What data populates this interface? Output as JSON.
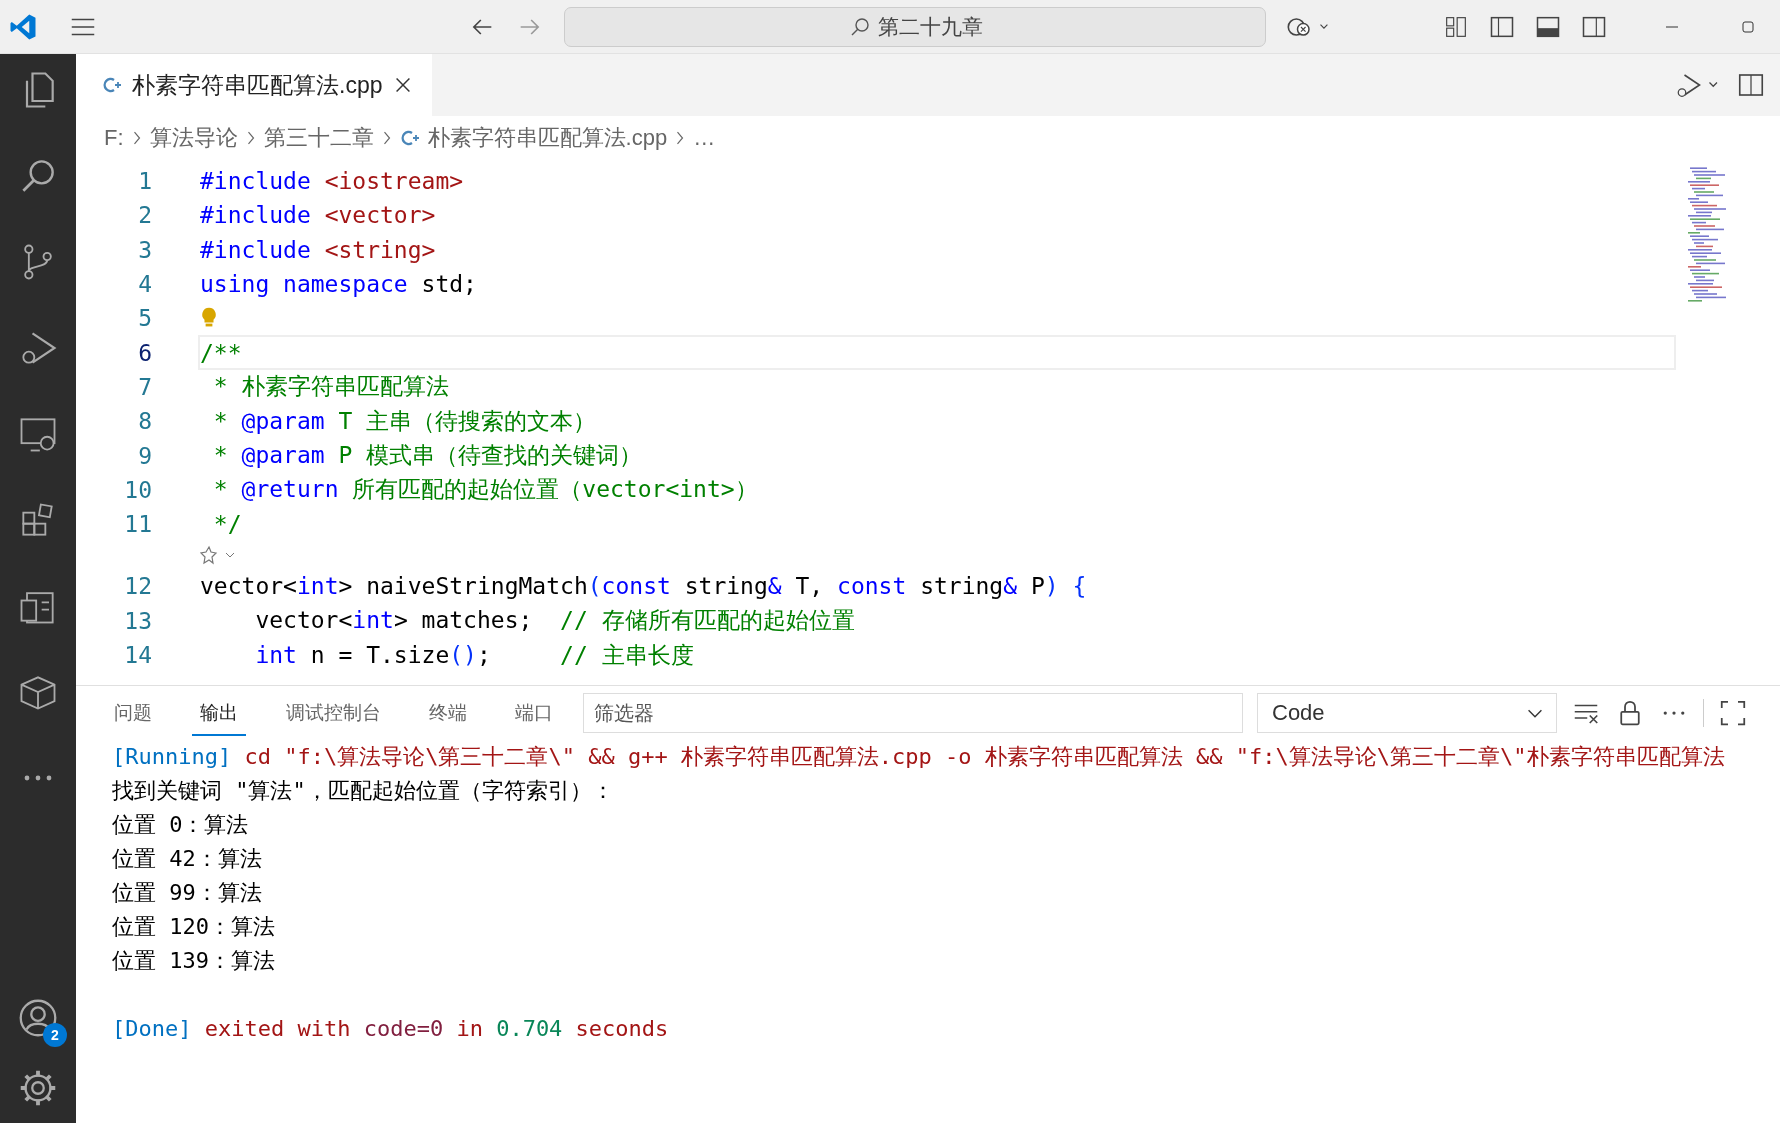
{
  "title_bar": {
    "search": "第二十九章"
  },
  "activity_bar": {
    "account_badge": "2"
  },
  "tabs": [
    {
      "label": "朴素字符串匹配算法.cpp",
      "selected": true
    }
  ],
  "breadcrumb": [
    {
      "label": "F:",
      "kind": "folder"
    },
    {
      "label": "算法导论",
      "kind": "folder"
    },
    {
      "label": "第三十二章",
      "kind": "folder"
    },
    {
      "label": "朴素字符串匹配算法.cpp",
      "kind": "file"
    },
    {
      "label": "…",
      "kind": "symbol"
    }
  ],
  "editor": {
    "lines": [
      {
        "kind": "code",
        "number": "1",
        "current": false,
        "tokens": [
          {
            "text": "#include ",
            "kind": "keyword"
          },
          {
            "text": "<iostream>",
            "kind": "string"
          }
        ]
      },
      {
        "kind": "code",
        "number": "2",
        "current": false,
        "tokens": [
          {
            "text": "#include ",
            "kind": "keyword"
          },
          {
            "text": "<vector>",
            "kind": "string"
          }
        ]
      },
      {
        "kind": "code",
        "number": "3",
        "current": false,
        "tokens": [
          {
            "text": "#include ",
            "kind": "keyword"
          },
          {
            "text": "<string>",
            "kind": "string"
          }
        ]
      },
      {
        "kind": "code",
        "number": "4",
        "current": false,
        "tokens": [
          {
            "text": "using namespace ",
            "kind": "keyword"
          },
          {
            "text": "std;",
            "kind": "plain"
          }
        ]
      },
      {
        "kind": "hint",
        "number": "5"
      },
      {
        "kind": "code",
        "number": "6",
        "current": true,
        "tokens": [
          {
            "text": "/**",
            "kind": "comment"
          }
        ]
      },
      {
        "kind": "code",
        "number": "7",
        "current": false,
        "tokens": [
          {
            "text": " * 朴素字符串匹配算法",
            "kind": "comment"
          }
        ]
      },
      {
        "kind": "code",
        "number": "8",
        "current": false,
        "tokens": [
          {
            "text": " * ",
            "kind": "comment"
          },
          {
            "text": "@param",
            "kind": "keyword"
          },
          {
            "text": " T 主串（待搜索的文本）",
            "kind": "comment"
          }
        ]
      },
      {
        "kind": "code",
        "number": "9",
        "current": false,
        "tokens": [
          {
            "text": " * ",
            "kind": "comment"
          },
          {
            "text": "@param",
            "kind": "keyword"
          },
          {
            "text": " P 模式串（待查找的关键词）",
            "kind": "comment"
          }
        ]
      },
      {
        "kind": "code",
        "number": "10",
        "current": false,
        "tokens": [
          {
            "text": " * ",
            "kind": "comment"
          },
          {
            "text": "@return",
            "kind": "keyword"
          },
          {
            "text": " 所有匹配的起始位置（vector<int>）",
            "kind": "comment"
          }
        ]
      },
      {
        "kind": "code",
        "number": "11",
        "current": false,
        "tokens": [
          {
            "text": " */",
            "kind": "comment"
          }
        ]
      },
      {
        "kind": "codelens"
      },
      {
        "kind": "code",
        "number": "12",
        "current": false,
        "tokens": [
          {
            "text": "vector<",
            "kind": "plain"
          },
          {
            "text": "int",
            "kind": "keyword"
          },
          {
            "text": "> naiveStringMatch",
            "kind": "plain"
          },
          {
            "text": "(",
            "kind": "bracket"
          },
          {
            "text": "const ",
            "kind": "keyword"
          },
          {
            "text": "string",
            "kind": "plain"
          },
          {
            "text": "& ",
            "kind": "keyword"
          },
          {
            "text": "T, ",
            "kind": "plain"
          },
          {
            "text": "const ",
            "kind": "keyword"
          },
          {
            "text": "string",
            "kind": "plain"
          },
          {
            "text": "& ",
            "kind": "keyword"
          },
          {
            "text": "P",
            "kind": "plain"
          },
          {
            "text": ") {",
            "kind": "bracket"
          }
        ]
      },
      {
        "kind": "code",
        "number": "13",
        "current": false,
        "tokens": [
          {
            "text": "    vector<",
            "kind": "plain"
          },
          {
            "text": "int",
            "kind": "keyword"
          },
          {
            "text": "> matches;  ",
            "kind": "plain"
          },
          {
            "text": "// 存储所有匹配的起始位置",
            "kind": "comment"
          }
        ]
      },
      {
        "kind": "code",
        "number": "14",
        "current": false,
        "tokens": [
          {
            "text": "    int",
            "kind": "keyword"
          },
          {
            "text": " n = T.size",
            "kind": "plain"
          },
          {
            "text": "()",
            "kind": "bracket"
          },
          {
            "text": ";     ",
            "kind": "plain"
          },
          {
            "text": "// 主串长度",
            "kind": "comment"
          }
        ]
      }
    ]
  },
  "panel": {
    "tabs": [
      {
        "label": "问题",
        "selected": false
      },
      {
        "label": "输出",
        "selected": true
      },
      {
        "label": "调试控制台",
        "selected": false
      },
      {
        "label": "终端",
        "selected": false
      },
      {
        "label": "端口",
        "selected": false
      }
    ],
    "filter": {
      "placeholder": "筛选器"
    },
    "channel": "Code",
    "output": [
      {
        "kind": "status",
        "tokens": [
          {
            "text": "[Running] ",
            "kind": "info"
          },
          {
            "text": "cd \"f:\\算法导论\\第三十二章\\\" && g++ 朴素字符串匹配算法.cpp -o 朴素字符串匹配算法 && \"f:\\算法导论\\第三十二章\\\"朴素字符串匹配算法",
            "kind": "error"
          }
        ]
      },
      {
        "kind": "text",
        "tokens": [
          {
            "text": "找到关键词 \"算法\"，匹配起始位置（字符索引）：",
            "kind": "plain"
          }
        ]
      },
      {
        "kind": "text",
        "tokens": [
          {
            "text": "位置 0：算法",
            "kind": "plain"
          }
        ]
      },
      {
        "kind": "text",
        "tokens": [
          {
            "text": "位置 42：算法",
            "kind": "plain"
          }
        ]
      },
      {
        "kind": "text",
        "tokens": [
          {
            "text": "位置 99：算法",
            "kind": "plain"
          }
        ]
      },
      {
        "kind": "text",
        "tokens": [
          {
            "text": "位置 120：算法",
            "kind": "plain"
          }
        ]
      },
      {
        "kind": "text",
        "tokens": [
          {
            "text": "位置 139：算法",
            "kind": "plain"
          }
        ]
      },
      {
        "kind": "status",
        "tokens": [
          {
            "text": "[Done] ",
            "kind": "info"
          },
          {
            "text": "exited with ",
            "kind": "error"
          },
          {
            "text": "code=0",
            "kind": "value"
          },
          {
            "text": " in ",
            "kind": "error"
          },
          {
            "text": "0.704",
            "kind": "number"
          },
          {
            "text": " seconds",
            "kind": "error"
          }
        ]
      }
    ]
  }
}
